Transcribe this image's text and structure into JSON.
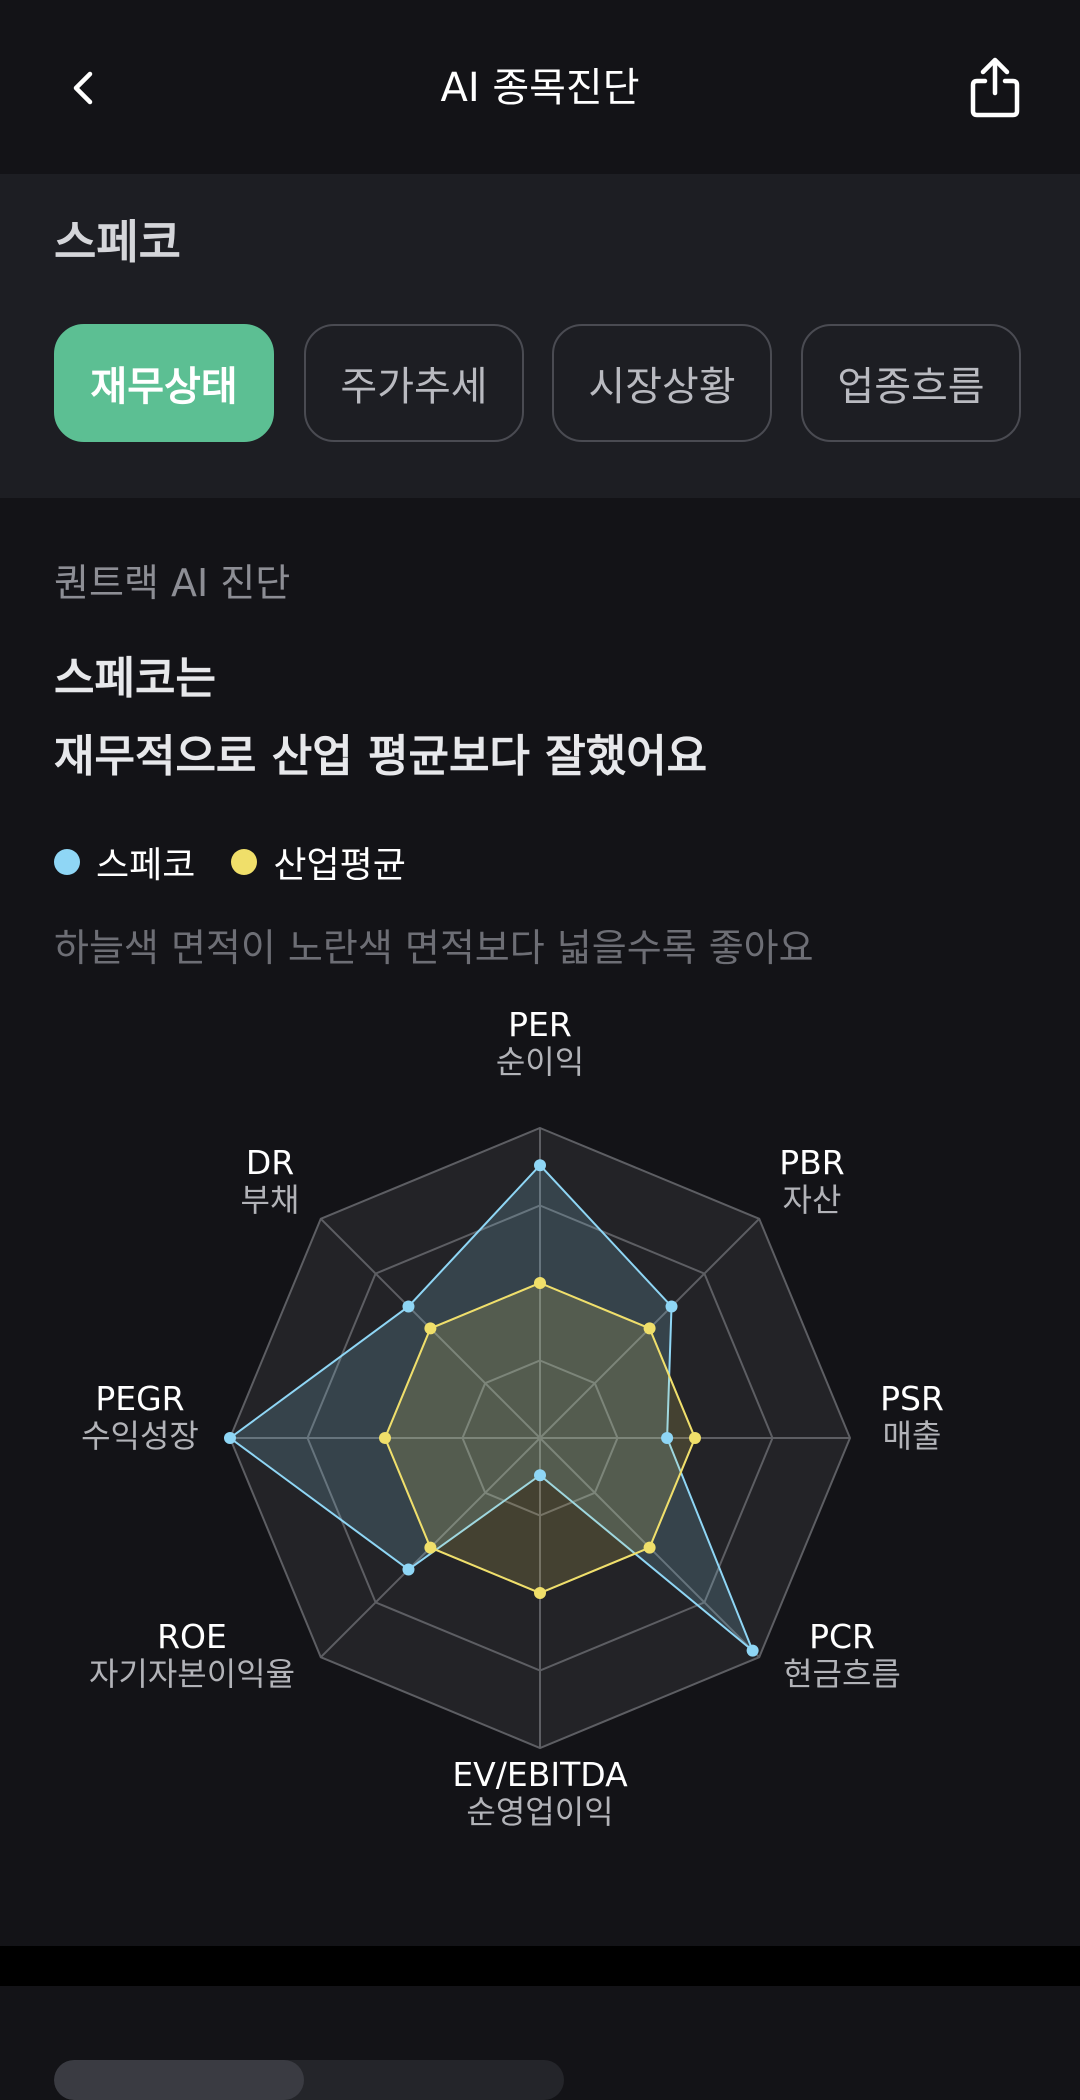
{
  "header": {
    "title": "AI 종목진단",
    "back_icon": "chevron-left-icon",
    "share_icon": "share-icon"
  },
  "stock": {
    "name": "스페코",
    "tabs": [
      {
        "label": "재무상태",
        "active": true
      },
      {
        "label": "주가추세",
        "active": false
      },
      {
        "label": "시장상황",
        "active": false
      },
      {
        "label": "업종흐름",
        "active": false
      }
    ]
  },
  "diagnosis": {
    "label": "퀀트랙 AI 진단",
    "headline_line1": "스페코는",
    "headline_line2": "재무적으로 산업 평균보다 잘했어요",
    "legend": [
      {
        "name": "스페코",
        "color": "#8fd6f5"
      },
      {
        "name": "산업평균",
        "color": "#f0df6a"
      }
    ],
    "hint": "하늘색 면적이 노란색 면적보다 넓을수록 좋아요"
  },
  "chart_data": {
    "type": "radar",
    "axes": [
      {
        "metric": "PER",
        "label": "순이익"
      },
      {
        "metric": "PBR",
        "label": "자산"
      },
      {
        "metric": "PSR",
        "label": "매출"
      },
      {
        "metric": "PCR",
        "label": "현금흐름"
      },
      {
        "metric": "EV/EBITDA",
        "label": "순영업이익"
      },
      {
        "metric": "ROE",
        "label": "자기자본이익율"
      },
      {
        "metric": "PEGR",
        "label": "수익성장"
      },
      {
        "metric": "DR",
        "label": "부채"
      }
    ],
    "rings": 4,
    "range": [
      0,
      1
    ],
    "series": [
      {
        "name": "스페코",
        "color": "#8fd6f5",
        "values": [
          0.88,
          0.6,
          0.41,
          0.97,
          0.12,
          0.6,
          1.0,
          0.6
        ]
      },
      {
        "name": "산업평균",
        "color": "#f0df6a",
        "values": [
          0.5,
          0.5,
          0.5,
          0.5,
          0.5,
          0.5,
          0.5,
          0.5
        ]
      }
    ]
  }
}
